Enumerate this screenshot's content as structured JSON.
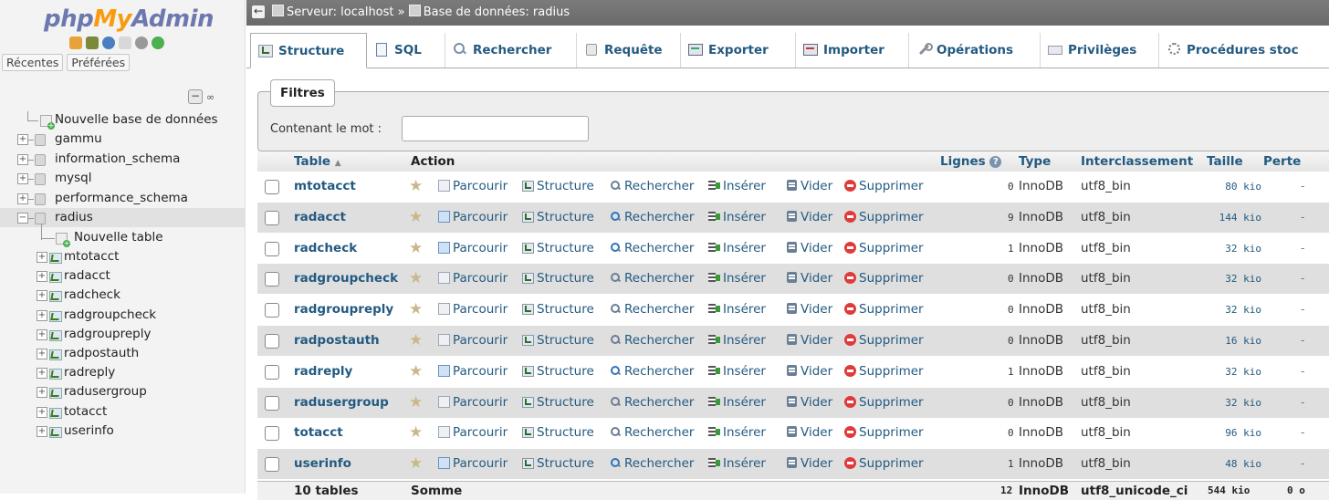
{
  "logo": {
    "php": "php",
    "my": "My",
    "admin": "Admin"
  },
  "nav": {
    "tabs": [
      "Récentes",
      "Préférées"
    ],
    "collapse_symbol": "−",
    "link_symbol": "∞",
    "new_db": "Nouvelle base de données",
    "databases": [
      "gammu",
      "information_schema",
      "mysql",
      "performance_schema",
      "radius"
    ],
    "new_table": "Nouvelle table",
    "tables": [
      "mtotacct",
      "radacct",
      "radcheck",
      "radgroupcheck",
      "radgroupreply",
      "radpostauth",
      "radreply",
      "radusergroup",
      "totacct",
      "userinfo"
    ]
  },
  "topbar": {
    "back": "←",
    "server": "Serveur: localhost",
    "sep": "»",
    "database": "Base de données: radius"
  },
  "menu": {
    "tabs": [
      "Structure",
      "SQL",
      "Rechercher",
      "Requête",
      "Exporter",
      "Importer",
      "Opérations",
      "Privilèges",
      "Procédures stoc"
    ]
  },
  "filter": {
    "legend": "Filtres",
    "label": "Contenant le mot :",
    "value": ""
  },
  "table": {
    "headers": {
      "table": "Table",
      "sort": "▲",
      "action": "Action",
      "rows": "Lignes",
      "help": "?",
      "type": "Type",
      "collation": "Interclassement",
      "size": "Taille",
      "overhead": "Perte"
    },
    "actions": {
      "browse": "Parcourir",
      "structure": "Structure",
      "search": "Rechercher",
      "insert": "Insérer",
      "empty": "Vider",
      "drop": "Supprimer"
    },
    "star": "★",
    "rows": [
      {
        "name": "mtotacct",
        "rows": "0",
        "type": "InnoDB",
        "collation": "utf8_bin",
        "size": "80 kio",
        "overhead": "-",
        "browse_on": false
      },
      {
        "name": "radacct",
        "rows": "9",
        "type": "InnoDB",
        "collation": "utf8_bin",
        "size": "144 kio",
        "overhead": "-",
        "browse_on": true
      },
      {
        "name": "radcheck",
        "rows": "1",
        "type": "InnoDB",
        "collation": "utf8_bin",
        "size": "32 kio",
        "overhead": "-",
        "browse_on": true
      },
      {
        "name": "radgroupcheck",
        "rows": "0",
        "type": "InnoDB",
        "collation": "utf8_bin",
        "size": "32 kio",
        "overhead": "-",
        "browse_on": false
      },
      {
        "name": "radgroupreply",
        "rows": "0",
        "type": "InnoDB",
        "collation": "utf8_bin",
        "size": "32 kio",
        "overhead": "-",
        "browse_on": false
      },
      {
        "name": "radpostauth",
        "rows": "0",
        "type": "InnoDB",
        "collation": "utf8_bin",
        "size": "16 kio",
        "overhead": "-",
        "browse_on": false
      },
      {
        "name": "radreply",
        "rows": "1",
        "type": "InnoDB",
        "collation": "utf8_bin",
        "size": "32 kio",
        "overhead": "-",
        "browse_on": true
      },
      {
        "name": "radusergroup",
        "rows": "0",
        "type": "InnoDB",
        "collation": "utf8_bin",
        "size": "32 kio",
        "overhead": "-",
        "browse_on": false
      },
      {
        "name": "totacct",
        "rows": "0",
        "type": "InnoDB",
        "collation": "utf8_bin",
        "size": "96 kio",
        "overhead": "-",
        "browse_on": false
      },
      {
        "name": "userinfo",
        "rows": "1",
        "type": "InnoDB",
        "collation": "utf8_bin",
        "size": "48 kio",
        "overhead": "-",
        "browse_on": true
      }
    ],
    "footer": {
      "count": "10 tables",
      "sum": "Somme",
      "rows": "12",
      "type": "InnoDB",
      "collation": "utf8_unicode_ci",
      "size": "544 kio",
      "overhead": "0 o"
    }
  }
}
